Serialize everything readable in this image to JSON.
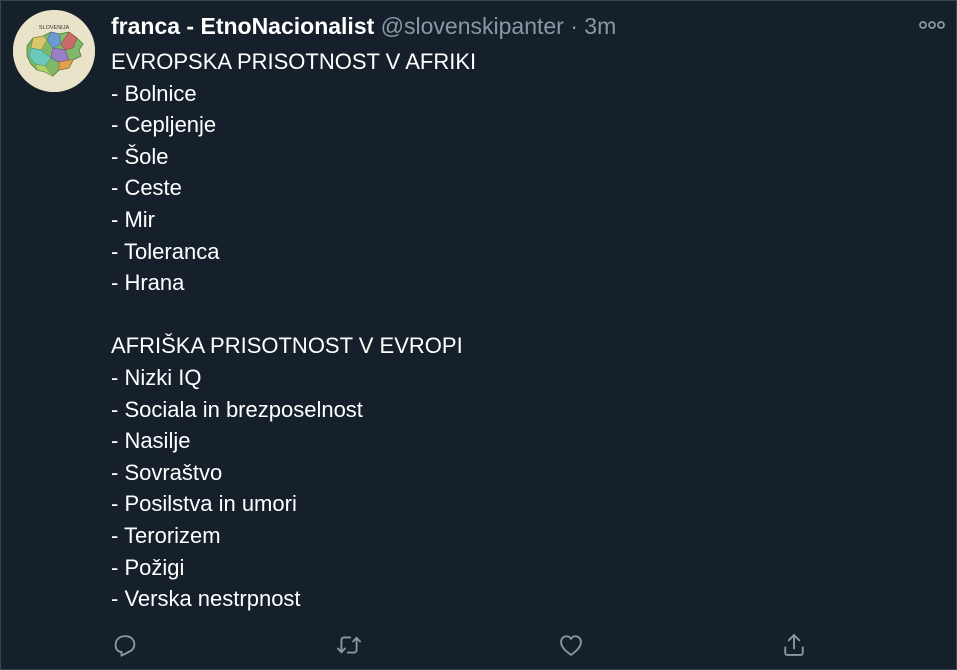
{
  "tweet": {
    "display_name": "franca - EtnoNacionalist",
    "handle": "@slovenskipanter",
    "separator": "·",
    "timestamp": "3m",
    "avatar_icon": "slovenia-map-avatar",
    "avatar_text": "SLOVENIJA",
    "more_icon": "more-horizontal-icon",
    "lines_block1": [
      "EVROPSKA PRISOTNOST V AFRIKI",
      "- Bolnice",
      "- Cepljenje",
      "- Šole",
      "- Ceste",
      "- Mir",
      "- Toleranca",
      "- Hrana"
    ],
    "lines_block2": [
      "AFRIŠKA PRISOTNOST V EVROPI",
      "- Nizki IQ",
      "- Sociala in brezposelnost",
      "- Nasilje",
      "- Sovraštvo",
      "- Posilstva in umori",
      "- Terorizem",
      "- Požigi",
      "- Verska nestrpnost"
    ]
  },
  "actions": [
    {
      "icon": "reply-icon"
    },
    {
      "icon": "retweet-icon"
    },
    {
      "icon": "like-icon"
    },
    {
      "icon": "share-icon"
    }
  ],
  "colors": {
    "background": "#15202b",
    "text": "#ffffff",
    "secondary_text": "#8899a6",
    "border": "#38444d"
  }
}
